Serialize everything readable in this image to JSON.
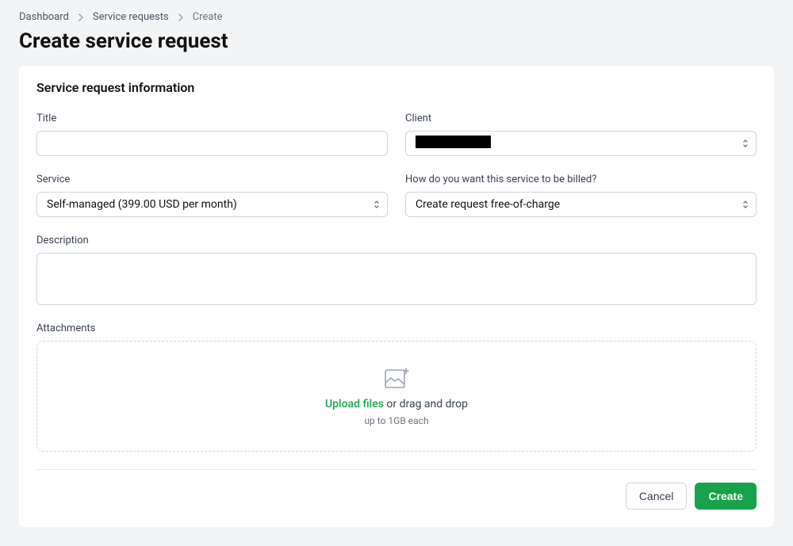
{
  "breadcrumb": {
    "items": [
      {
        "label": "Dashboard"
      },
      {
        "label": "Service requests"
      },
      {
        "label": "Create"
      }
    ]
  },
  "page": {
    "title": "Create service request"
  },
  "section": {
    "heading": "Service request information"
  },
  "fields": {
    "title": {
      "label": "Title",
      "value": ""
    },
    "client": {
      "label": "Client",
      "value": ""
    },
    "service": {
      "label": "Service",
      "value": "Self-managed (399.00 USD per month)"
    },
    "billing": {
      "label": "How do you want this service to be billed?",
      "value": "Create request free-of-charge"
    },
    "description": {
      "label": "Description",
      "value": ""
    },
    "attachments": {
      "label": "Attachments",
      "link_text": "Upload files",
      "suffix_text": " or drag and drop",
      "sub_text": "up to 1GB each"
    }
  },
  "actions": {
    "cancel": "Cancel",
    "create": "Create"
  },
  "colors": {
    "accent": "#16a34a"
  }
}
